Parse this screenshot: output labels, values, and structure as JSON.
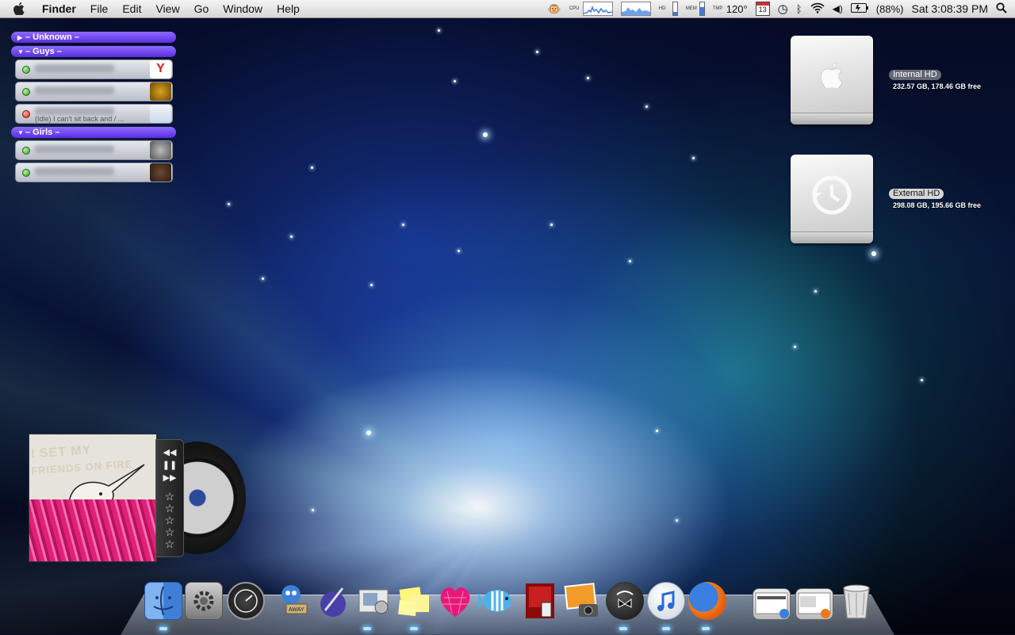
{
  "menubar": {
    "app_name": "Finder",
    "menus": [
      "File",
      "Edit",
      "View",
      "Go",
      "Window",
      "Help"
    ],
    "cpu_label": "CPU",
    "hd_label": "HD",
    "mem_label": "MEM",
    "tmp_label": "TMP",
    "temperature": "120°",
    "calendar_day": "13",
    "battery": "(88%)",
    "clock": "Sat 3:08:39 PM",
    "icons": [
      "apple-icon",
      "monkey-icon",
      "cpu-graph",
      "network-graph",
      "calendar-icon",
      "time-machine-icon",
      "bluetooth-icon",
      "wifi-icon",
      "volume-icon",
      "battery-icon",
      "spotlight-icon"
    ]
  },
  "buddy_list": {
    "groups": [
      {
        "label": "– Unknown –",
        "expanded": false
      },
      {
        "label": "– Guys –",
        "expanded": true
      },
      {
        "label": "– Girls –",
        "expanded": true
      }
    ],
    "guys": [
      {
        "state": "available",
        "status": ""
      },
      {
        "state": "available",
        "status": ""
      },
      {
        "state": "idle",
        "status": "(Idle) I can't sit back and / ..."
      }
    ],
    "girls": [
      {
        "state": "available",
        "status": ""
      },
      {
        "state": "available",
        "status": ""
      }
    ]
  },
  "drives": [
    {
      "label": "Internal HD",
      "info": "232.57 GB, 178.46 GB free",
      "icon": "apple-logo-icon"
    },
    {
      "label": "External HD",
      "info": "298.08 GB, 195.66 GB free",
      "icon": "time-machine-icon"
    }
  ],
  "album": {
    "cover_text_1": "I SET MY",
    "cover_text_2": "FRIENDS ON FIRE",
    "controls": {
      "prev": "◀◀",
      "pause": "❚❚",
      "next": "▶▶"
    },
    "star": "☆",
    "rating": 0
  },
  "dock": {
    "items": [
      "finder-icon",
      "system-preferences-icon",
      "dashboard-icon",
      "twitterrific-icon",
      "script-editor-icon",
      "mail-icon",
      "stickies-icon",
      "heart-app-icon",
      "fish-app-icon",
      "photo-booth-icon",
      "iphoto-icon",
      "camino-icon",
      "itunes-icon",
      "firefox-icon",
      "stack-1-icon",
      "stack-2-icon",
      "trash-icon"
    ]
  },
  "colors": {
    "group_purple": "#6a3df0",
    "available": "#2c9a1c",
    "idle": "#d42a1e"
  }
}
